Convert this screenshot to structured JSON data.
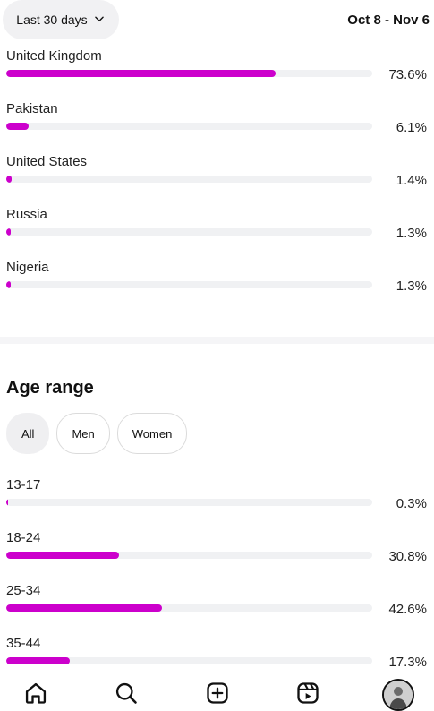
{
  "header": {
    "range_label": "Last 30 days",
    "date_range": "Oct 8 - Nov 6"
  },
  "countries": [
    {
      "label": "United Kingdom",
      "value": "73.6%",
      "fraction": 0.736
    },
    {
      "label": "Pakistan",
      "value": "6.1%",
      "fraction": 0.061
    },
    {
      "label": "United States",
      "value": "1.4%",
      "fraction": 0.014
    },
    {
      "label": "Russia",
      "value": "1.3%",
      "fraction": 0.013
    },
    {
      "label": "Nigeria",
      "value": "1.3%",
      "fraction": 0.013
    }
  ],
  "age": {
    "title": "Age range",
    "filters": [
      "All",
      "Men",
      "Women"
    ],
    "active_filter": "All",
    "rows": [
      {
        "label": "13-17",
        "value": "0.3%",
        "fraction": 0.003
      },
      {
        "label": "18-24",
        "value": "30.8%",
        "fraction": 0.308
      },
      {
        "label": "25-34",
        "value": "42.6%",
        "fraction": 0.426
      },
      {
        "label": "35-44",
        "value": "17.3%",
        "fraction": 0.173
      }
    ]
  },
  "bar_color": "#cc00cc",
  "bottom_nav": [
    "home-icon",
    "search-icon",
    "create-icon",
    "reels-icon",
    "profile-avatar"
  ]
}
